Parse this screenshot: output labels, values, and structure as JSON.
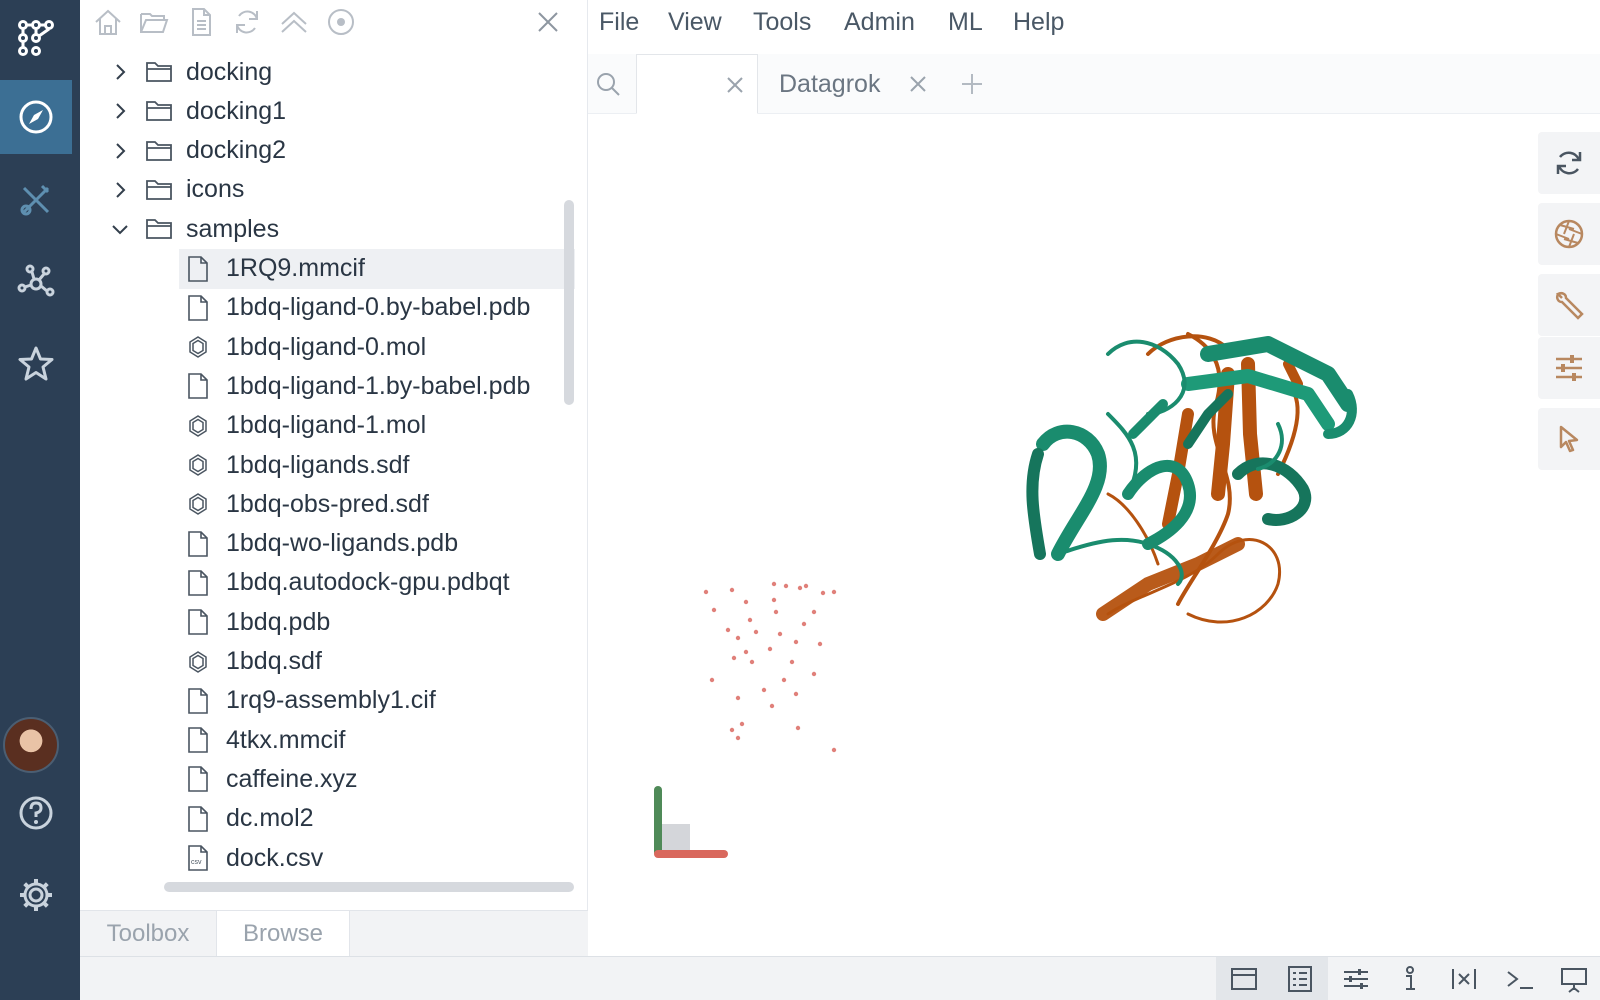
{
  "app": {
    "brand_color": "#2c3f55",
    "accent_color": "#3c6f94",
    "sidebar_icons": [
      "datagrok-logo-icon",
      "browse-compass-icon",
      "functions-icon",
      "network-icon",
      "favorites-star-icon",
      "user-avatar",
      "help-icon",
      "settings-gear-icon"
    ]
  },
  "browse_toolbar": {
    "icons": [
      "home-icon",
      "open-folder-icon",
      "file-icon",
      "refresh-icon",
      "collapse-up-icon",
      "target-icon",
      "close-icon"
    ]
  },
  "tree": {
    "folders_top": [
      {
        "label": "docking",
        "expanded": false
      },
      {
        "label": "docking1",
        "expanded": false
      },
      {
        "label": "docking2",
        "expanded": false
      },
      {
        "label": "icons",
        "expanded": false
      },
      {
        "label": "samples",
        "expanded": true
      }
    ],
    "files": [
      {
        "label": "1RQ9.mmcif",
        "icon": "file",
        "selected": true
      },
      {
        "label": "1bdq-ligand-0.by-babel.pdb",
        "icon": "file"
      },
      {
        "label": "1bdq-ligand-0.mol",
        "icon": "molecule"
      },
      {
        "label": "1bdq-ligand-1.by-babel.pdb",
        "icon": "file"
      },
      {
        "label": "1bdq-ligand-1.mol",
        "icon": "molecule"
      },
      {
        "label": "1bdq-ligands.sdf",
        "icon": "molecule"
      },
      {
        "label": "1bdq-obs-pred.sdf",
        "icon": "molecule"
      },
      {
        "label": "1bdq-wo-ligands.pdb",
        "icon": "file"
      },
      {
        "label": "1bdq.autodock-gpu.pdbqt",
        "icon": "file"
      },
      {
        "label": "1bdq.pdb",
        "icon": "file"
      },
      {
        "label": "1bdq.sdf",
        "icon": "molecule"
      },
      {
        "label": "1rq9-assembly1.cif",
        "icon": "file"
      },
      {
        "label": "4tkx.mmcif",
        "icon": "file"
      },
      {
        "label": "caffeine.xyz",
        "icon": "file"
      },
      {
        "label": "dc.mol2",
        "icon": "file"
      },
      {
        "label": "dock.csv",
        "icon": "csv"
      }
    ]
  },
  "bottom_tabs": [
    {
      "label": "Toolbox",
      "active": false
    },
    {
      "label": "Browse",
      "active": true
    }
  ],
  "menu": [
    "File",
    "View",
    "Tools",
    "Admin",
    "ML",
    "Help"
  ],
  "tabs": [
    {
      "label": "",
      "active": true
    },
    {
      "label": "Datagrok",
      "active": false
    }
  ],
  "viewer": {
    "protein_colors": {
      "chain_a": "#1a8c6e",
      "chain_b": "#b5520f"
    },
    "water_color": "#e0807a"
  },
  "right_tools": [
    "reset-view-icon",
    "camera-aperture-icon",
    "wrench-icon",
    "settings-sliders-icon",
    "pointer-icon"
  ],
  "statusbar_icons": [
    "layout-icon",
    "properties-list-icon",
    "filters-icon",
    "info-icon",
    "variables-icon",
    "console-icon",
    "presentation-icon"
  ]
}
